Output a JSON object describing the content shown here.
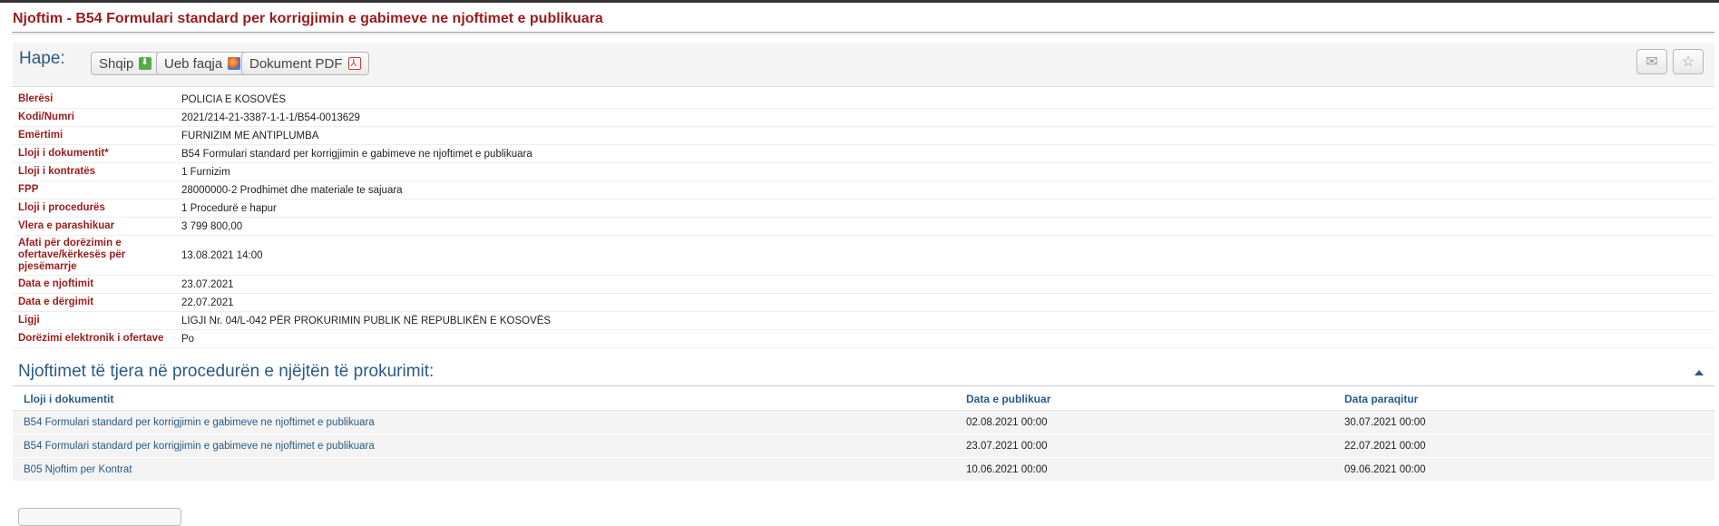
{
  "page": {
    "title": "Njoftim - B54 Formulari standard per korrigjimin e gabimeve ne njoftimet e publikuara"
  },
  "toolbar": {
    "open_label": "Hape:",
    "buttons": [
      {
        "label": "Shqip",
        "icon": "download-icon"
      },
      {
        "label": "Ueb faqja",
        "icon": "globe-icon"
      },
      {
        "label": "Dokument PDF",
        "icon": "pdf-icon"
      }
    ],
    "right_icons": [
      "envelope-icon",
      "star-icon"
    ]
  },
  "details": [
    {
      "label": "Blerësi",
      "value": "POLICIA E KOSOVËS"
    },
    {
      "label": "Kodi/Numri",
      "value": "2021/214-21-3387-1-1-1/B54-0013629"
    },
    {
      "label": "Emërtimi",
      "value": "FURNIZIM ME ANTIPLUMBA"
    },
    {
      "label": "Lloji i dokumentit*",
      "value": "B54 Formulari standard per korrigjimin e gabimeve ne njoftimet e publikuara"
    },
    {
      "label": "Lloji i kontratës",
      "value": "1 Furnizim"
    },
    {
      "label": "FPP",
      "value": "28000000-2 Prodhimet dhe materiale te sajuara"
    },
    {
      "label": "Lloji i procedurës",
      "value": "1 Procedurë e hapur"
    },
    {
      "label": "Vlera e parashikuar",
      "value": "3 799 800,00"
    },
    {
      "label": "Afati për dorëzimin e ofertave/kërkesës për pjesëmarrje",
      "value": "13.08.2021 14:00"
    },
    {
      "label": "Data e njoftimit",
      "value": "23.07.2021"
    },
    {
      "label": "Data e dërgimit",
      "value": "22.07.2021"
    },
    {
      "label": "Ligji",
      "value": "LIGJI Nr. 04/L-042 PËR PROKURIMIN PUBLIK NË REPUBLIKËN E KOSOVËS"
    },
    {
      "label": "Dorëzimi elektronik i ofertave",
      "value": "Po"
    }
  ],
  "related": {
    "title": "Njoftimet të tjera në procedurën e njëjtën të prokurimit:",
    "headers": [
      "Lloji i dokumentit",
      "Data e publikuar",
      "Data paraqitur"
    ],
    "rows": [
      [
        "B54 Formulari standard per korrigjimin e gabimeve ne njoftimet e publikuara",
        "02.08.2021 00:00",
        "30.07.2021 00:00"
      ],
      [
        "B54 Formulari standard per korrigjimin e gabimeve ne njoftimet e publikuara",
        "23.07.2021 00:00",
        "22.07.2021 00:00"
      ],
      [
        "B05 Njoftim per Kontrat",
        "10.06.2021 00:00",
        "09.06.2021 00:00"
      ]
    ]
  },
  "colors": {
    "title_red": "#9b1b1b",
    "link_blue": "#2a5a86"
  }
}
